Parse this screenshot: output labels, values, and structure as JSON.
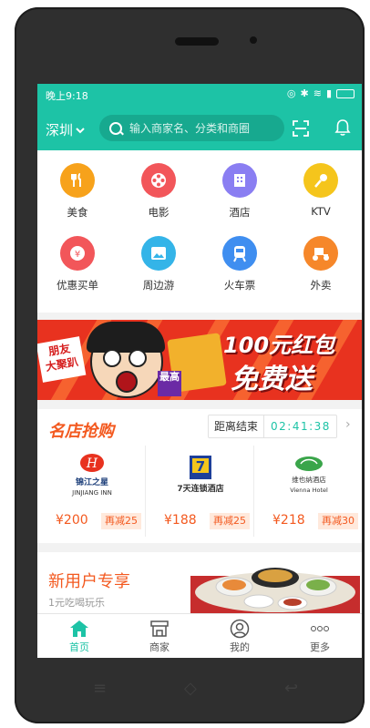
{
  "status_bar": {
    "time": "晚上9:18"
  },
  "header": {
    "city": "深圳",
    "search_placeholder": "输入商家名、分类和商圈"
  },
  "categories": [
    {
      "label": "美食",
      "icon": "fork-knife-icon",
      "color": "#f7a21b"
    },
    {
      "label": "电影",
      "icon": "film-reel-icon",
      "color": "#f2565a"
    },
    {
      "label": "酒店",
      "icon": "building-icon",
      "color": "#8a7ef2"
    },
    {
      "label": "KTV",
      "icon": "microphone-icon",
      "color": "#f5c51c"
    },
    {
      "label": "优惠买单",
      "icon": "coupon-icon",
      "color": "#f2565a"
    },
    {
      "label": "周边游",
      "icon": "mountain-icon",
      "color": "#34b4e8"
    },
    {
      "label": "火车票",
      "icon": "train-icon",
      "color": "#3f8ef0"
    },
    {
      "label": "外卖",
      "icon": "scooter-icon",
      "color": "#f6872a"
    }
  ],
  "banner": {
    "corner_line1": "朋友",
    "corner_line2": "大聚趴",
    "tag": "最高",
    "headline1": "100元红包",
    "headline2": "免费送"
  },
  "famous": {
    "title": "名店抢购",
    "countdown_label": "距离结束",
    "countdown": "02:41:38",
    "shops": [
      {
        "name_cn": "锦江之星",
        "name_en": "JINJIANG INN",
        "price": "¥200",
        "discount": "再减25"
      },
      {
        "name_cn": "7天连锁酒店",
        "name_en": "",
        "price": "¥188",
        "discount": "再减25"
      },
      {
        "name_cn": "维也纳酒店",
        "name_en": "Vienna Hotel",
        "price": "¥218",
        "discount": "再减30"
      }
    ]
  },
  "new_user": {
    "title": "新用户专享",
    "subtitle": "1元吃喝玩乐"
  },
  "tabs": [
    {
      "label": "首页",
      "active": true
    },
    {
      "label": "商家",
      "active": false
    },
    {
      "label": "我的",
      "active": false
    },
    {
      "label": "更多",
      "active": false
    }
  ],
  "colors": {
    "brand": "#1dc3a6",
    "accent": "#f3591f"
  }
}
